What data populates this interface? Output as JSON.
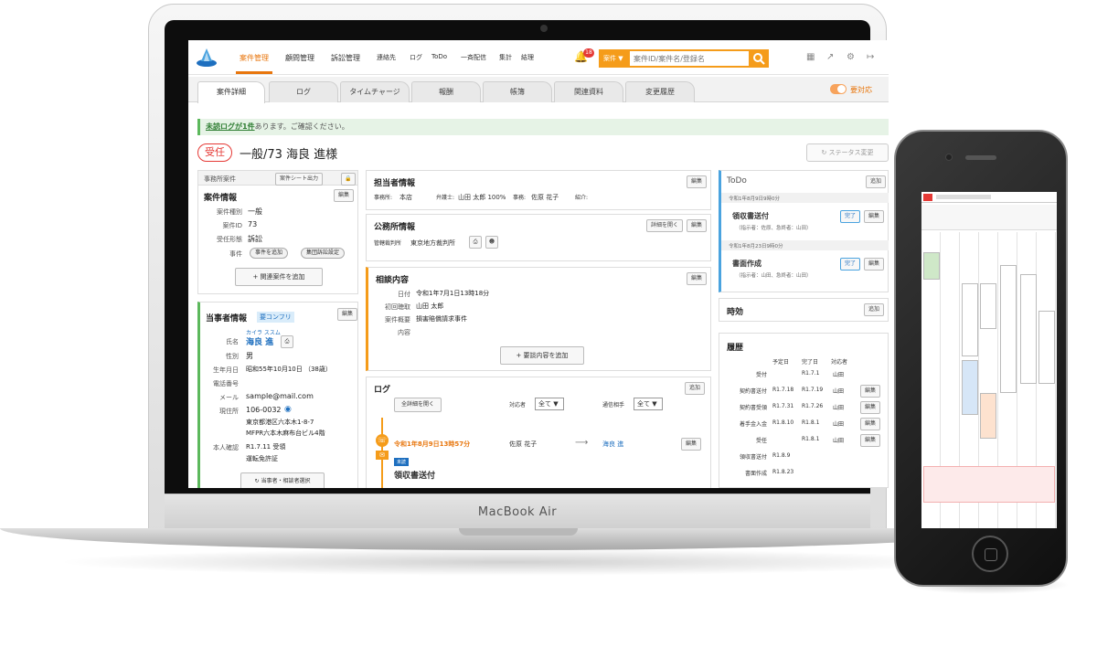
{
  "nav": {
    "items": [
      "案件管理",
      "顧問管理",
      "訴訟管理",
      "連絡先",
      "ログ",
      "ToDo",
      "一斉配信",
      "集計",
      "結理"
    ],
    "notif_count": "18",
    "search_scope": "案件 ▼",
    "search_placeholder": "案件ID/案件名/登録名"
  },
  "tabs": [
    "案件詳細",
    "ログ",
    "タイムチャージ",
    "報酬",
    "帳簿",
    "関連資料",
    "変更履歴"
  ],
  "toggle_label": "要対応",
  "notice": {
    "link": "未読ログが1件",
    "text": "あります。ご確認ください。"
  },
  "case": {
    "badge": "受任",
    "title": "一般/73 海良 進様",
    "status_button": "ステータス変更"
  },
  "office_case": {
    "header": "事務所案件",
    "sheet_button": "案件シート出力",
    "title": "案件情報",
    "edit": "編集",
    "rows": [
      {
        "label": "案件種別",
        "value": "一般"
      },
      {
        "label": "案件ID",
        "value": "73"
      },
      {
        "label": "受任形態",
        "value": "訴訟"
      }
    ],
    "event_label": "事件",
    "event_buttons": [
      "事件を追加",
      "集団訴訟設定"
    ],
    "add_related": "+ 関連案件を追加"
  },
  "party": {
    "title": "当事者情報",
    "tag": "要コンフリ",
    "edit": "編集",
    "kana": "カイラ ススム",
    "name": "海良 進",
    "rows": [
      {
        "label": "氏名",
        "value": ""
      },
      {
        "label": "性別",
        "value": "男"
      },
      {
        "label": "生年月日",
        "value": "昭和55年10月10日 （38歳）"
      },
      {
        "label": "電話番号",
        "value": ""
      },
      {
        "label": "メール",
        "value": "sample@mail.com"
      },
      {
        "label": "現住所",
        "value": "106-0032"
      },
      {
        "label": "",
        "value": "東京都港区六本木1-8-7"
      },
      {
        "label": "",
        "value": "MFPR六本木麻布台ビル4階"
      },
      {
        "label": "本人確認",
        "value": "R1.7.11 受領"
      },
      {
        "label": "",
        "value": "運転免許証"
      }
    ],
    "select_button": "当事者・相談者選択"
  },
  "staff": {
    "title": "担当者情報",
    "edit": "編集",
    "line": [
      {
        "label": "事務所:",
        "value": "本店"
      },
      {
        "label": "弁護士:",
        "value": "山田 太郎 100%"
      },
      {
        "label": "事務:",
        "value": "佐原 花子"
      },
      {
        "label": "紹介:",
        "value": ""
      }
    ]
  },
  "court": {
    "title": "公務所情報",
    "detail_button": "詳細を開く",
    "edit": "編集",
    "label": "管轄裁判所",
    "value": "東京地方裁判所"
  },
  "consult": {
    "title": "相談内容",
    "edit": "編集",
    "rows": [
      {
        "label": "日付",
        "value": "令和1年7月1日13時18分"
      },
      {
        "label": "初回聴取",
        "value": "山田 太郎"
      },
      {
        "label": "案件概要",
        "value": "損害賠償請求事件"
      },
      {
        "label": "内容",
        "value": ""
      }
    ],
    "add_button": "+ 要談内容を追加"
  },
  "log": {
    "title": "ログ",
    "add": "追加",
    "expand_button": "全詳細を開く",
    "filter1_label": "対応者",
    "filter1_value": "全て ▼",
    "filter2_label": "通信相手",
    "filter2_value": "全て ▼",
    "entry_date": "令和1年8月9日13時57分",
    "entry_from": "佐原 花子",
    "entry_to": "海良 進",
    "entry_edit": "編集",
    "entry_tag": "未読",
    "entry_title": "領収書送付"
  },
  "todo": {
    "title": "ToDo",
    "add": "追加",
    "items": [
      {
        "date": "令和1年8月9日9時0分",
        "title": "領収書送付",
        "meta": "（指示者：佐原、急終者：山田）",
        "done": "完了",
        "edit": "編集"
      },
      {
        "date": "令和1年8月23日9時0分",
        "title": "書面作成",
        "meta": "（指示者：山田、急終者：山田）",
        "done": "完了",
        "edit": "編集"
      }
    ]
  },
  "limitation": {
    "title": "時効",
    "add": "追加"
  },
  "history": {
    "title": "履歴",
    "columns": [
      "予定日",
      "完了日",
      "対応者"
    ],
    "rows": [
      {
        "name": "受付",
        "plan": "",
        "done": "R1.7.1",
        "by": "山田",
        "edit": ""
      },
      {
        "name": "契約書送付",
        "plan": "R1.7.18",
        "done": "R1.7.19",
        "by": "山田",
        "edit": "編集"
      },
      {
        "name": "契約書受領",
        "plan": "R1.7.31",
        "done": "R1.7.26",
        "by": "山田",
        "edit": "編集"
      },
      {
        "name": "着手金入金",
        "plan": "R1.8.10",
        "done": "R1.8.1",
        "by": "山田",
        "edit": "編集"
      },
      {
        "name": "受任",
        "plan": "",
        "done": "R1.8.1",
        "by": "山田",
        "edit": "編集"
      },
      {
        "name": "領収書送付",
        "plan": "R1.8.9",
        "done": "",
        "by": "",
        "edit": ""
      },
      {
        "name": "書面作成",
        "plan": "R1.8.23",
        "done": "",
        "by": "",
        "edit": ""
      }
    ]
  },
  "laptop_brand": "MacBook Air",
  "colors": {
    "accent": "#e8760d",
    "search": "#f59c1a",
    "danger": "#e53935",
    "link": "#1e6fbf",
    "success": "#5cb85c"
  }
}
